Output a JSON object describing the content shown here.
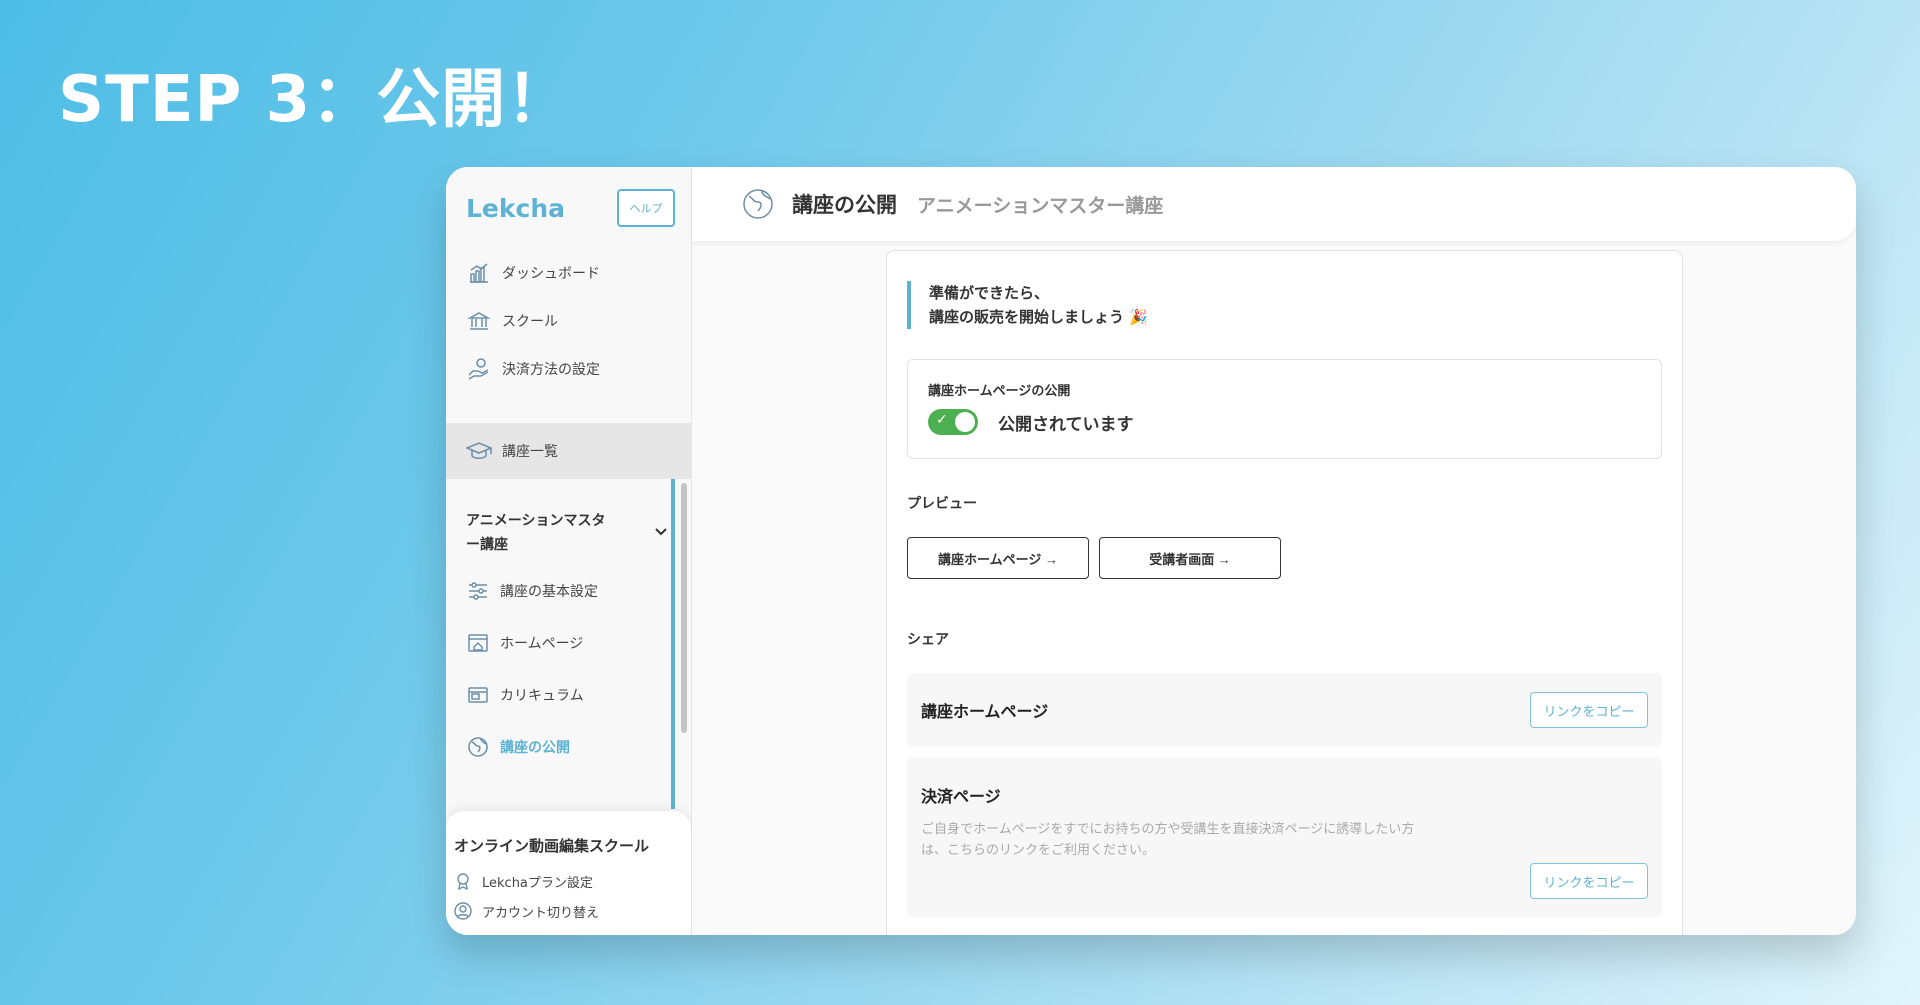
{
  "step_title": "STEP 3：公開！",
  "sidebar": {
    "logo": "Lekcha",
    "help_label": "ヘルプ",
    "nav": [
      {
        "label": "ダッシュボード",
        "icon": "chart-icon"
      },
      {
        "label": "スクール",
        "icon": "bank-icon"
      },
      {
        "label": "決済方法の設定",
        "icon": "payment-hand-icon"
      }
    ],
    "course_list_label": "講座一覧",
    "course_name": "アニメーションマスター講座",
    "course_menu": [
      {
        "label": "講座の基本設定",
        "icon": "sliders-icon"
      },
      {
        "label": "ホームページ",
        "icon": "home-page-icon"
      },
      {
        "label": "カリキュラム",
        "icon": "curriculum-icon"
      },
      {
        "label": "講座の公開",
        "icon": "globe-icon"
      }
    ],
    "footer": {
      "school_name": "オンライン動画編集スクール",
      "plan_label": "Lekchaプラン設定",
      "account_label": "アカウント切り替え"
    }
  },
  "header": {
    "page_title": "講座の公開",
    "course_name": "アニメーションマスター講座"
  },
  "main": {
    "intro_line1": "準備ができたら、",
    "intro_line2": "講座の販売を開始しましょう 🎉",
    "publish_label": "講座ホームページの公開",
    "publish_status": "公開されています",
    "publish_on": true,
    "preview_label": "プレビュー",
    "preview_buttons": [
      "講座ホームページ →",
      "受講者画面 →"
    ],
    "share_label": "シェア",
    "share_items": [
      {
        "title": "講座ホームページ",
        "copy_label": "リンクをコピー"
      },
      {
        "title": "決済ページ",
        "description": "ご自身でホームページをすでにお持ちの方や受講生を直接決済ページに誘導したい方は、こちらのリンクをご利用ください。",
        "copy_label": "リンクをコピー"
      }
    ]
  },
  "colors": {
    "accent": "#5eb2d4",
    "toggle_on": "#4caf50",
    "background_start": "#4dbde6",
    "background_end": "#e1f4fb"
  }
}
